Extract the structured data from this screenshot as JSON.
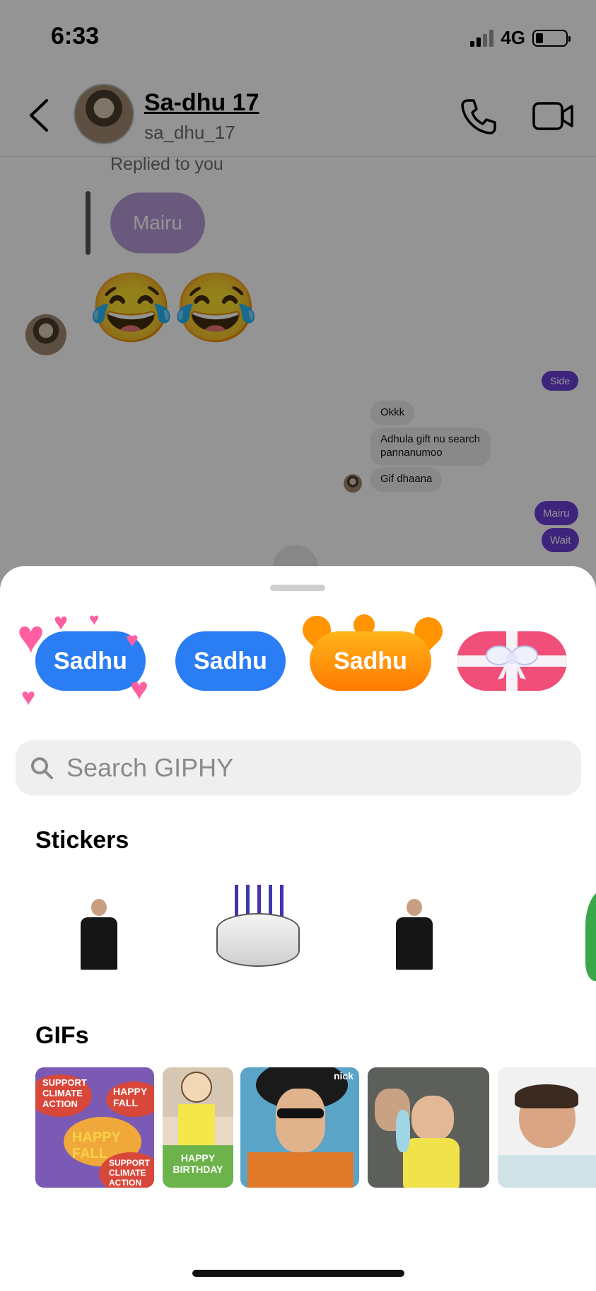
{
  "status_bar": {
    "time": "6:33",
    "network": "4G"
  },
  "header": {
    "name": "Sa-dhu 17",
    "username": "sa_dhu_17"
  },
  "chat": {
    "replied_label": "Replied to you",
    "reply_message": "Mairu",
    "emoji_message": "😂😂",
    "out_partial": "Side",
    "incoming": [
      "Okkk",
      "Adhula gift nu search pannanumoo",
      "Gif dhaana"
    ],
    "outgoing": [
      "Mairu",
      "Wait"
    ]
  },
  "sheet": {
    "name_stickers": [
      "Sadhu",
      "Sadhu",
      "Sadhu"
    ],
    "search_placeholder": "Search GIPHY",
    "stickers_title": "Stickers",
    "gifs_title": "GIFs",
    "gif_captions": {
      "fall": [
        "SUPPORT CLIMATE ACTION",
        "HAPPY FALL",
        "HAPPY FALL",
        "SUPPORT CLIMATE ACTION"
      ],
      "birthday": "HAPPY BIRTHDAY",
      "nick": "nick"
    }
  },
  "colors": {
    "accent_purple": "#6b3fd8",
    "sticker_blue": "#2a7df2",
    "sticker_orange": "#ff9400",
    "gift_pink": "#ef4f78"
  }
}
